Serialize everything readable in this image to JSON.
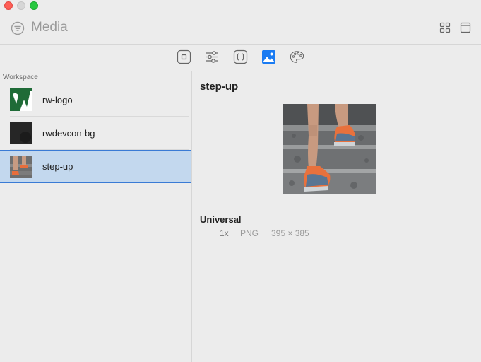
{
  "window": {
    "title": "Media"
  },
  "sidebar": {
    "section_label": "Workspace",
    "items": [
      {
        "label": "rw-logo"
      },
      {
        "label": "rwdevcon-bg"
      },
      {
        "label": "step-up"
      }
    ]
  },
  "detail": {
    "title": "step-up",
    "section": "Universal",
    "scale": "1x",
    "format": "PNG",
    "dimensions": "395 × 385"
  },
  "icons": {
    "filter": "filter-icon",
    "grid": "grid-view-icon",
    "panel": "panel-icon",
    "toolbar": [
      "button-icon",
      "sliders-icon",
      "braces-icon",
      "image-icon",
      "palette-icon"
    ]
  },
  "colors": {
    "accent": "#1a7bf2",
    "selection": "#c3d8ee",
    "logo_green": "#1f6b37"
  }
}
